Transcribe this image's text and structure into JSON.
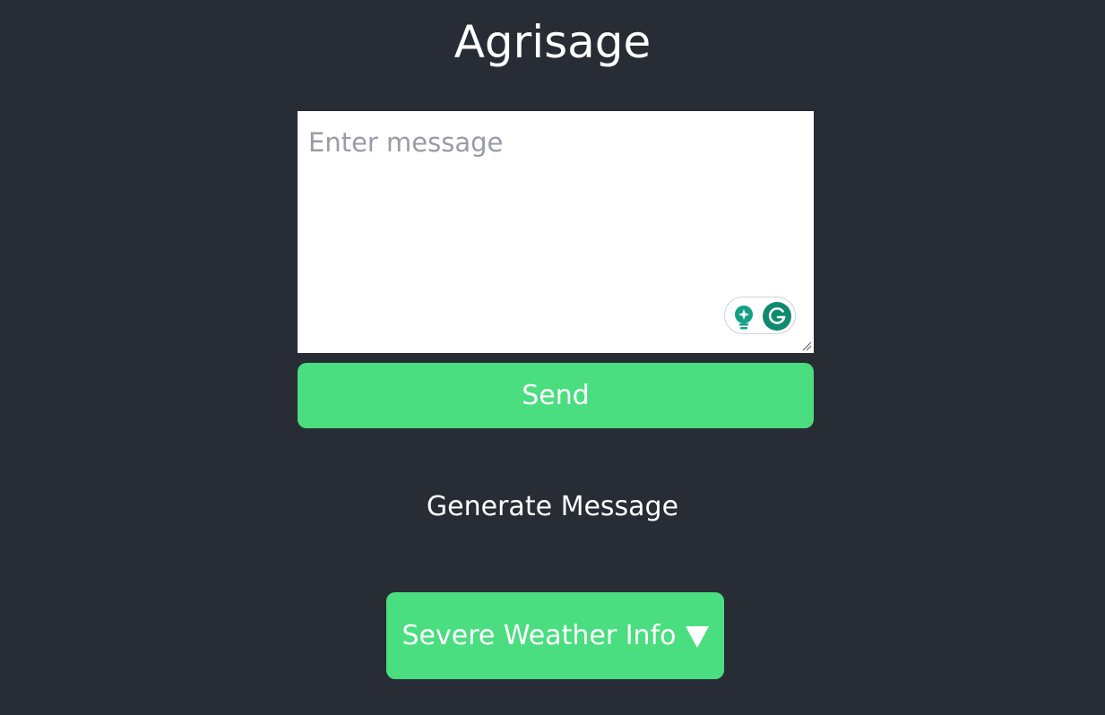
{
  "app": {
    "title": "Agrisage"
  },
  "composer": {
    "placeholder": "Enter message",
    "value": ""
  },
  "actions": {
    "send_label": "Send",
    "generate_label": "Generate Message",
    "weather_label": "Severe Weather Info",
    "weather_icon": "triangle-down-icon"
  },
  "theme": {
    "background": "#282c34",
    "accent": "#4ade80",
    "grammarly_green": "#15a085"
  }
}
